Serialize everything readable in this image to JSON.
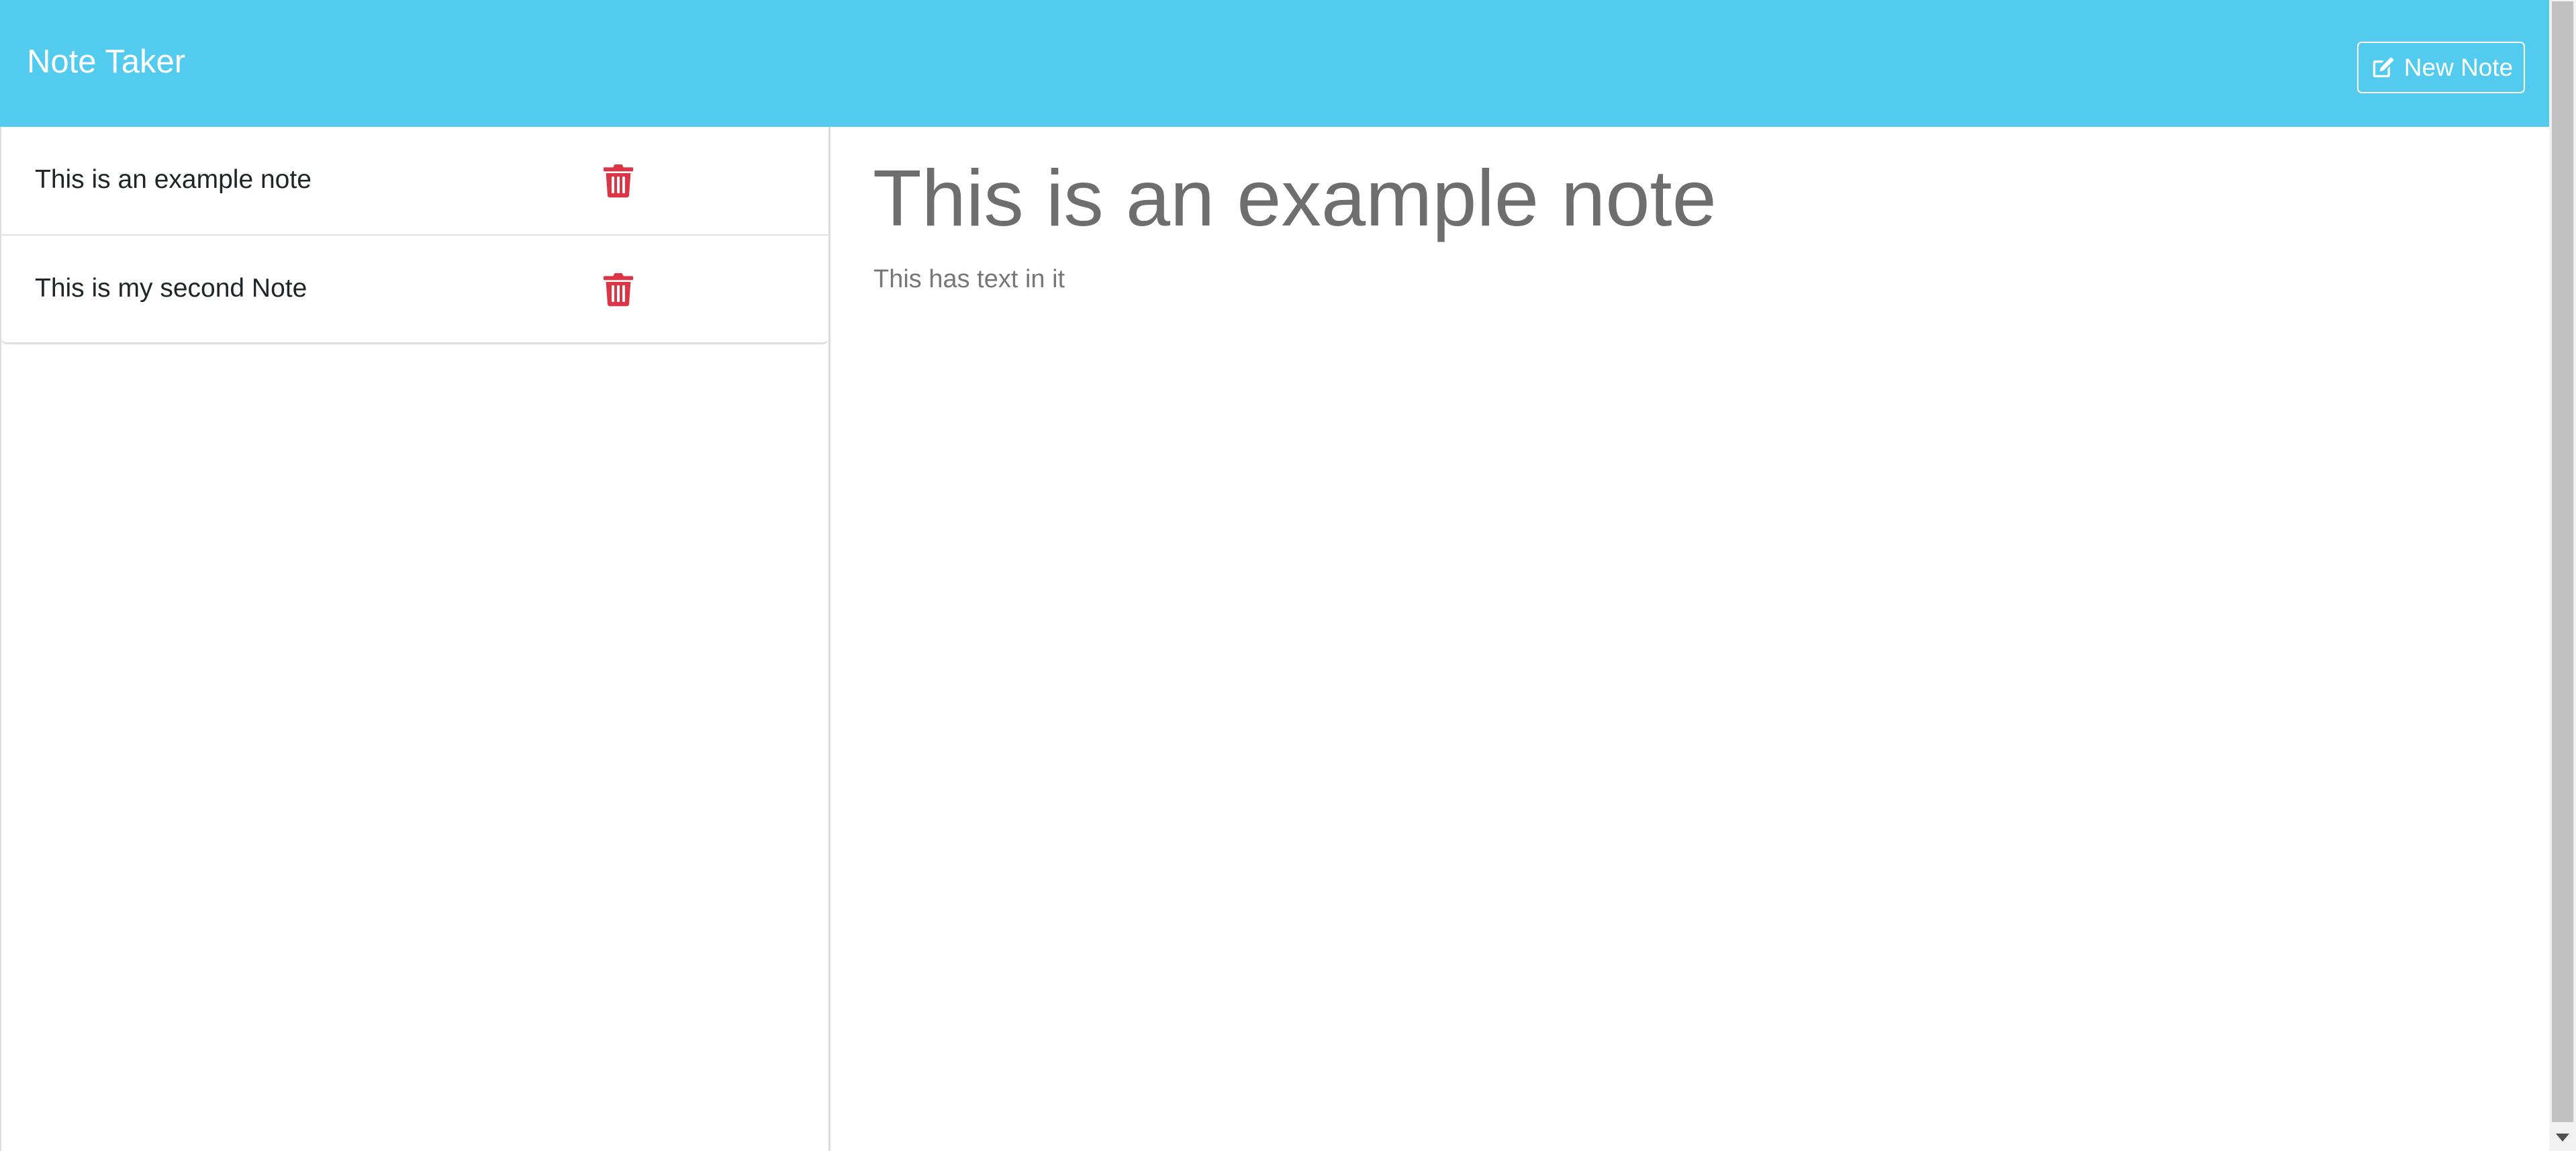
{
  "app": {
    "title": "Note Taker",
    "new_note_label": "New Note",
    "new_note_icon": "pen-to-square-icon"
  },
  "notes": [
    {
      "title": "This is an example note",
      "delete_icon": "trash-icon"
    },
    {
      "title": "This is my second Note",
      "delete_icon": "trash-icon"
    }
  ],
  "active_note": {
    "title": "This is an example note",
    "text": "This has text in it"
  },
  "colors": {
    "navbar": "#52cbef",
    "delete": "#dc3545",
    "heading_text": "#6e6e6e"
  }
}
